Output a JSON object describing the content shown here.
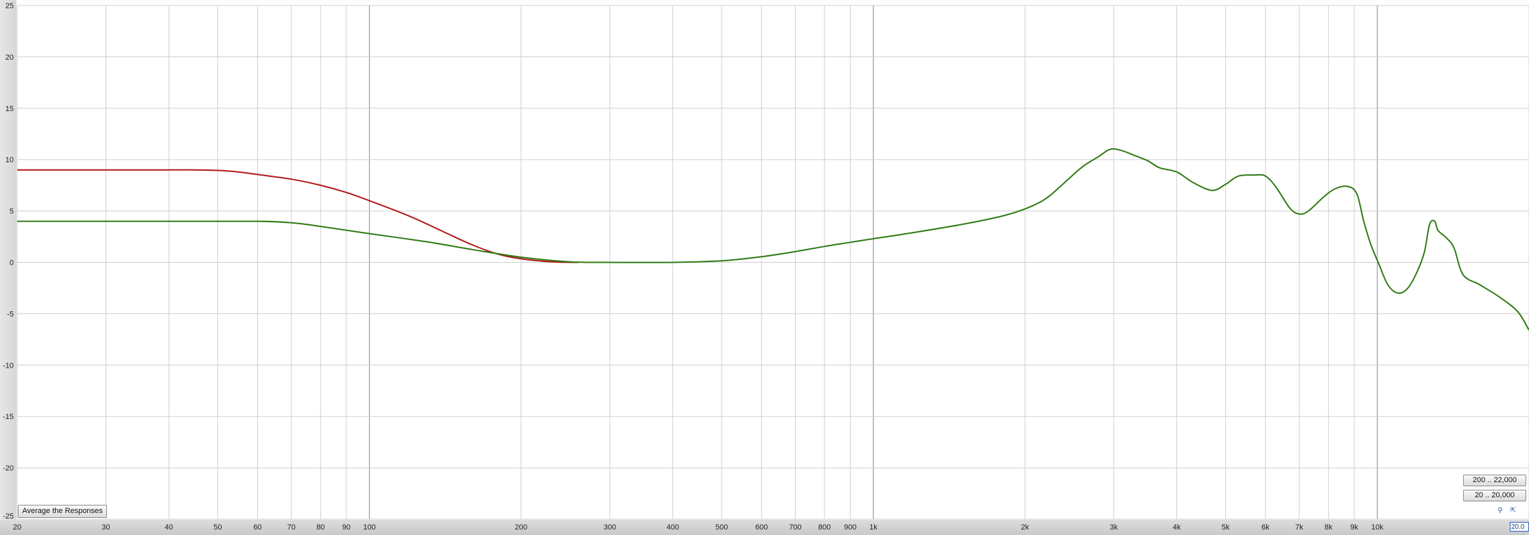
{
  "chart_data": {
    "type": "line",
    "x_scale": "log",
    "xlim": [
      20,
      20000
    ],
    "ylim": [
      -25,
      25
    ],
    "grid": true,
    "x_tick_labels": [
      {
        "v": 20,
        "label": "20"
      },
      {
        "v": 30,
        "label": "30"
      },
      {
        "v": 40,
        "label": "40"
      },
      {
        "v": 50,
        "label": "50"
      },
      {
        "v": 60,
        "label": "60"
      },
      {
        "v": 70,
        "label": "70"
      },
      {
        "v": 80,
        "label": "80"
      },
      {
        "v": 90,
        "label": "90"
      },
      {
        "v": 100,
        "label": "100"
      },
      {
        "v": 200,
        "label": "200"
      },
      {
        "v": 300,
        "label": "300"
      },
      {
        "v": 400,
        "label": "400"
      },
      {
        "v": 500,
        "label": "500"
      },
      {
        "v": 600,
        "label": "600"
      },
      {
        "v": 700,
        "label": "700"
      },
      {
        "v": 800,
        "label": "800"
      },
      {
        "v": 900,
        "label": "900"
      },
      {
        "v": 1000,
        "label": "1k"
      },
      {
        "v": 2000,
        "label": "2k"
      },
      {
        "v": 3000,
        "label": "3k"
      },
      {
        "v": 4000,
        "label": "4k"
      },
      {
        "v": 5000,
        "label": "5k"
      },
      {
        "v": 6000,
        "label": "6k"
      },
      {
        "v": 7000,
        "label": "7k"
      },
      {
        "v": 8000,
        "label": "8k"
      },
      {
        "v": 9000,
        "label": "9k"
      },
      {
        "v": 10000,
        "label": "10k"
      }
    ],
    "y_tick_labels": [
      {
        "v": 25,
        "label": "25"
      },
      {
        "v": 20,
        "label": "20"
      },
      {
        "v": 15,
        "label": "15"
      },
      {
        "v": 10,
        "label": "10"
      },
      {
        "v": 5,
        "label": "5"
      },
      {
        "v": 0,
        "label": "0"
      },
      {
        "v": -5,
        "label": "-5"
      },
      {
        "v": -10,
        "label": "-10"
      },
      {
        "v": -15,
        "label": "-15"
      },
      {
        "v": -20,
        "label": "-20"
      },
      {
        "v": -25,
        "label": "-25"
      }
    ],
    "series": [
      {
        "color": "#b01818",
        "points": [
          [
            20,
            9.0
          ],
          [
            30,
            9.0
          ],
          [
            40,
            9.0
          ],
          [
            45,
            9.0
          ],
          [
            50,
            8.95
          ],
          [
            55,
            8.8
          ],
          [
            60,
            8.55
          ],
          [
            70,
            8.1
          ],
          [
            80,
            7.5
          ],
          [
            90,
            6.8
          ],
          [
            100,
            6.0
          ],
          [
            120,
            4.5
          ],
          [
            140,
            3.0
          ],
          [
            160,
            1.7
          ],
          [
            180,
            0.8
          ],
          [
            200,
            0.35
          ],
          [
            230,
            0.05
          ],
          [
            260,
            0.0
          ]
        ]
      },
      {
        "color": "#2d7a12",
        "points": [
          [
            20,
            4.0
          ],
          [
            40,
            4.0
          ],
          [
            60,
            4.0
          ],
          [
            70,
            3.85
          ],
          [
            80,
            3.5
          ],
          [
            100,
            2.8
          ],
          [
            130,
            2.0
          ],
          [
            160,
            1.25
          ],
          [
            200,
            0.5
          ],
          [
            250,
            0.05
          ],
          [
            300,
            0.0
          ],
          [
            400,
            0.0
          ],
          [
            500,
            0.15
          ],
          [
            600,
            0.55
          ],
          [
            700,
            1.05
          ],
          [
            800,
            1.55
          ],
          [
            900,
            1.95
          ],
          [
            1000,
            2.3
          ],
          [
            1200,
            2.9
          ],
          [
            1500,
            3.7
          ],
          [
            1800,
            4.5
          ],
          [
            2000,
            5.2
          ],
          [
            2200,
            6.2
          ],
          [
            2400,
            7.8
          ],
          [
            2600,
            9.3
          ],
          [
            2800,
            10.3
          ],
          [
            2950,
            11.0
          ],
          [
            3100,
            10.9
          ],
          [
            3300,
            10.4
          ],
          [
            3500,
            9.9
          ],
          [
            3700,
            9.2
          ],
          [
            4000,
            8.8
          ],
          [
            4300,
            7.8
          ],
          [
            4700,
            7.0
          ],
          [
            5000,
            7.6
          ],
          [
            5300,
            8.4
          ],
          [
            5700,
            8.5
          ],
          [
            6000,
            8.4
          ],
          [
            6300,
            7.3
          ],
          [
            6700,
            5.3
          ],
          [
            7000,
            4.7
          ],
          [
            7300,
            5.0
          ],
          [
            7800,
            6.3
          ],
          [
            8200,
            7.1
          ],
          [
            8700,
            7.4
          ],
          [
            9100,
            6.7
          ],
          [
            9400,
            4.0
          ],
          [
            9700,
            1.8
          ],
          [
            10100,
            -0.3
          ],
          [
            10500,
            -2.2
          ],
          [
            11000,
            -3.0
          ],
          [
            11500,
            -2.5
          ],
          [
            12000,
            -0.9
          ],
          [
            12400,
            1.0
          ],
          [
            12700,
            3.7
          ],
          [
            13000,
            4.0
          ],
          [
            13200,
            3.1
          ],
          [
            13700,
            2.4
          ],
          [
            14200,
            1.4
          ],
          [
            14800,
            -1.2
          ],
          [
            16000,
            -2.2
          ],
          [
            17500,
            -3.4
          ],
          [
            19000,
            -4.8
          ],
          [
            20000,
            -6.6
          ]
        ]
      }
    ]
  },
  "controls": {
    "average_label": "Average the Responses",
    "range_1_label": "200 .. 22,000",
    "range_2_label": "20 .. 20,000",
    "freq_value": "20.0",
    "tool_icon_a": "zoom-tool-icon",
    "tool_icon_b": "cursor-tool-icon"
  }
}
